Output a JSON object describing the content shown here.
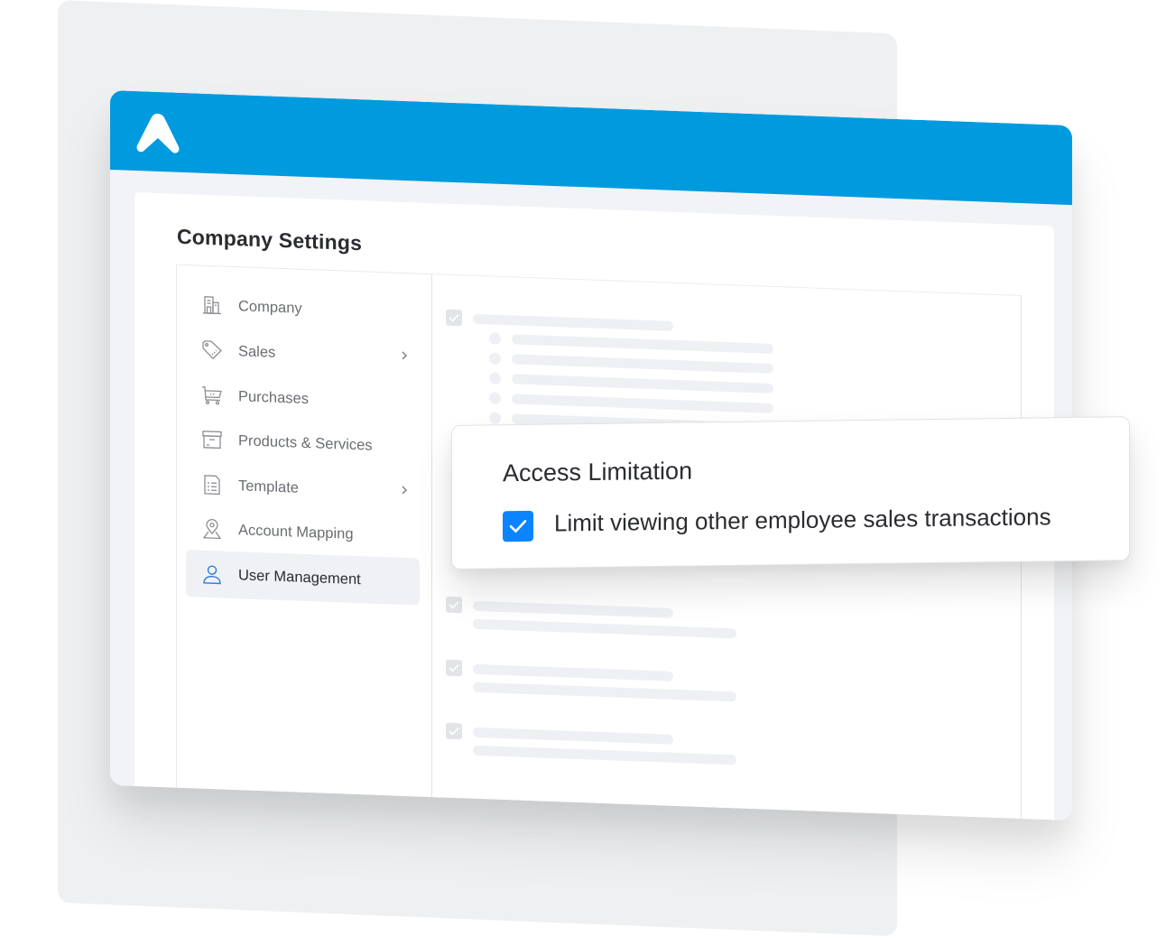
{
  "app": {
    "brand_color": "#009ade",
    "logo_icon": "caret-up-logo-icon"
  },
  "page": {
    "title": "Company Settings"
  },
  "sidebar": {
    "items": [
      {
        "label": "Company",
        "icon": "building-icon",
        "has_submenu": false,
        "active": false
      },
      {
        "label": "Sales",
        "icon": "price-tag-icon",
        "has_submenu": true,
        "active": false
      },
      {
        "label": "Purchases",
        "icon": "shopping-cart-icon",
        "has_submenu": false,
        "active": false
      },
      {
        "label": "Products & Services",
        "icon": "archive-box-icon",
        "has_submenu": false,
        "active": false
      },
      {
        "label": "Template",
        "icon": "document-list-icon",
        "has_submenu": true,
        "active": false
      },
      {
        "label": "Account Mapping",
        "icon": "map-pin-icon",
        "has_submenu": false,
        "active": false
      },
      {
        "label": "User Management",
        "icon": "user-icon",
        "has_submenu": false,
        "active": true
      }
    ],
    "active_color": "#2d7be0"
  },
  "popup": {
    "title": "Access Limitation",
    "option_label": "Limit viewing other employee sales transactions",
    "option_checked": true,
    "checkbox_color": "#0a84ff"
  }
}
